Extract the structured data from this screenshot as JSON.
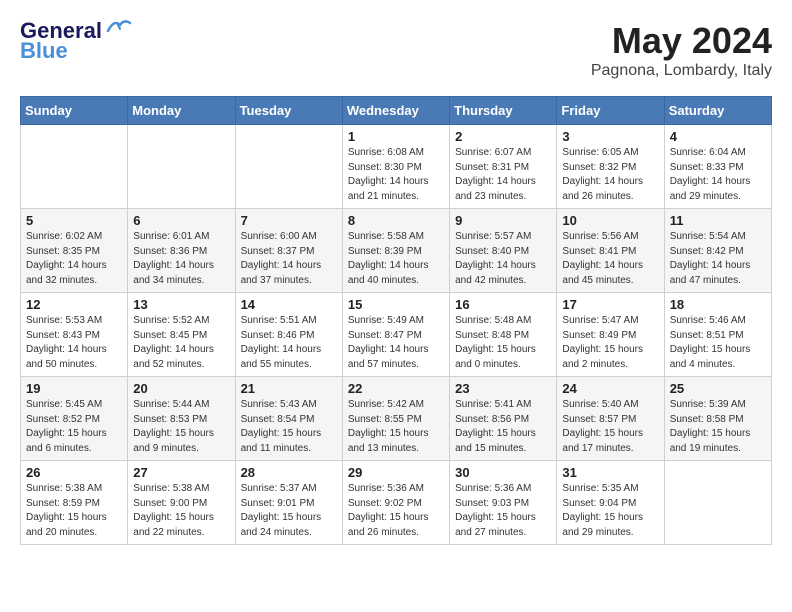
{
  "header": {
    "logo_general": "General",
    "logo_blue": "Blue",
    "month_title": "May 2024",
    "subtitle": "Pagnona, Lombardy, Italy"
  },
  "days_of_week": [
    "Sunday",
    "Monday",
    "Tuesday",
    "Wednesday",
    "Thursday",
    "Friday",
    "Saturday"
  ],
  "weeks": [
    [
      {
        "day": "",
        "info": ""
      },
      {
        "day": "",
        "info": ""
      },
      {
        "day": "",
        "info": ""
      },
      {
        "day": "1",
        "info": "Sunrise: 6:08 AM\nSunset: 8:30 PM\nDaylight: 14 hours\nand 21 minutes."
      },
      {
        "day": "2",
        "info": "Sunrise: 6:07 AM\nSunset: 8:31 PM\nDaylight: 14 hours\nand 23 minutes."
      },
      {
        "day": "3",
        "info": "Sunrise: 6:05 AM\nSunset: 8:32 PM\nDaylight: 14 hours\nand 26 minutes."
      },
      {
        "day": "4",
        "info": "Sunrise: 6:04 AM\nSunset: 8:33 PM\nDaylight: 14 hours\nand 29 minutes."
      }
    ],
    [
      {
        "day": "5",
        "info": "Sunrise: 6:02 AM\nSunset: 8:35 PM\nDaylight: 14 hours\nand 32 minutes."
      },
      {
        "day": "6",
        "info": "Sunrise: 6:01 AM\nSunset: 8:36 PM\nDaylight: 14 hours\nand 34 minutes."
      },
      {
        "day": "7",
        "info": "Sunrise: 6:00 AM\nSunset: 8:37 PM\nDaylight: 14 hours\nand 37 minutes."
      },
      {
        "day": "8",
        "info": "Sunrise: 5:58 AM\nSunset: 8:39 PM\nDaylight: 14 hours\nand 40 minutes."
      },
      {
        "day": "9",
        "info": "Sunrise: 5:57 AM\nSunset: 8:40 PM\nDaylight: 14 hours\nand 42 minutes."
      },
      {
        "day": "10",
        "info": "Sunrise: 5:56 AM\nSunset: 8:41 PM\nDaylight: 14 hours\nand 45 minutes."
      },
      {
        "day": "11",
        "info": "Sunrise: 5:54 AM\nSunset: 8:42 PM\nDaylight: 14 hours\nand 47 minutes."
      }
    ],
    [
      {
        "day": "12",
        "info": "Sunrise: 5:53 AM\nSunset: 8:43 PM\nDaylight: 14 hours\nand 50 minutes."
      },
      {
        "day": "13",
        "info": "Sunrise: 5:52 AM\nSunset: 8:45 PM\nDaylight: 14 hours\nand 52 minutes."
      },
      {
        "day": "14",
        "info": "Sunrise: 5:51 AM\nSunset: 8:46 PM\nDaylight: 14 hours\nand 55 minutes."
      },
      {
        "day": "15",
        "info": "Sunrise: 5:49 AM\nSunset: 8:47 PM\nDaylight: 14 hours\nand 57 minutes."
      },
      {
        "day": "16",
        "info": "Sunrise: 5:48 AM\nSunset: 8:48 PM\nDaylight: 15 hours\nand 0 minutes."
      },
      {
        "day": "17",
        "info": "Sunrise: 5:47 AM\nSunset: 8:49 PM\nDaylight: 15 hours\nand 2 minutes."
      },
      {
        "day": "18",
        "info": "Sunrise: 5:46 AM\nSunset: 8:51 PM\nDaylight: 15 hours\nand 4 minutes."
      }
    ],
    [
      {
        "day": "19",
        "info": "Sunrise: 5:45 AM\nSunset: 8:52 PM\nDaylight: 15 hours\nand 6 minutes."
      },
      {
        "day": "20",
        "info": "Sunrise: 5:44 AM\nSunset: 8:53 PM\nDaylight: 15 hours\nand 9 minutes."
      },
      {
        "day": "21",
        "info": "Sunrise: 5:43 AM\nSunset: 8:54 PM\nDaylight: 15 hours\nand 11 minutes."
      },
      {
        "day": "22",
        "info": "Sunrise: 5:42 AM\nSunset: 8:55 PM\nDaylight: 15 hours\nand 13 minutes."
      },
      {
        "day": "23",
        "info": "Sunrise: 5:41 AM\nSunset: 8:56 PM\nDaylight: 15 hours\nand 15 minutes."
      },
      {
        "day": "24",
        "info": "Sunrise: 5:40 AM\nSunset: 8:57 PM\nDaylight: 15 hours\nand 17 minutes."
      },
      {
        "day": "25",
        "info": "Sunrise: 5:39 AM\nSunset: 8:58 PM\nDaylight: 15 hours\nand 19 minutes."
      }
    ],
    [
      {
        "day": "26",
        "info": "Sunrise: 5:38 AM\nSunset: 8:59 PM\nDaylight: 15 hours\nand 20 minutes."
      },
      {
        "day": "27",
        "info": "Sunrise: 5:38 AM\nSunset: 9:00 PM\nDaylight: 15 hours\nand 22 minutes."
      },
      {
        "day": "28",
        "info": "Sunrise: 5:37 AM\nSunset: 9:01 PM\nDaylight: 15 hours\nand 24 minutes."
      },
      {
        "day": "29",
        "info": "Sunrise: 5:36 AM\nSunset: 9:02 PM\nDaylight: 15 hours\nand 26 minutes."
      },
      {
        "day": "30",
        "info": "Sunrise: 5:36 AM\nSunset: 9:03 PM\nDaylight: 15 hours\nand 27 minutes."
      },
      {
        "day": "31",
        "info": "Sunrise: 5:35 AM\nSunset: 9:04 PM\nDaylight: 15 hours\nand 29 minutes."
      },
      {
        "day": "",
        "info": ""
      }
    ]
  ]
}
